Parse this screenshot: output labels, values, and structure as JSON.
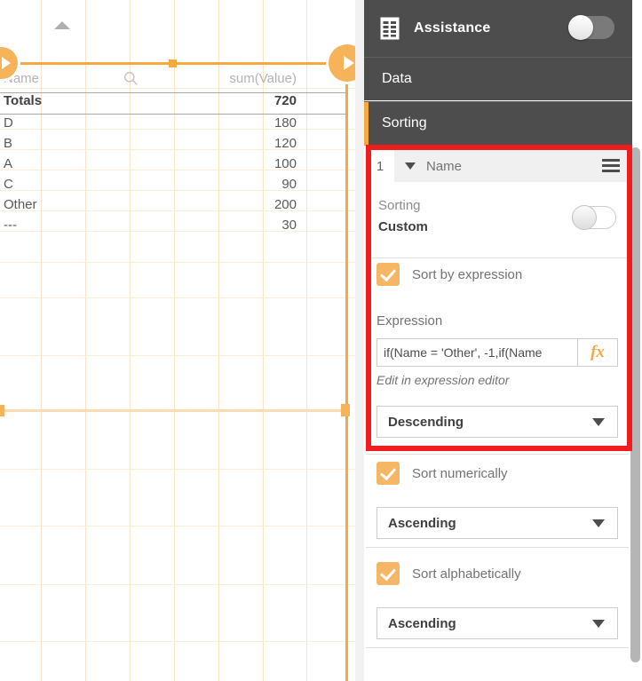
{
  "panel": {
    "title": "Assistance",
    "icon": "table-icon",
    "toggle_state": "off",
    "tabs": [
      {
        "label": "Data",
        "active": false
      },
      {
        "label": "Sorting",
        "active": true
      }
    ],
    "accent_color": "#f5a93e",
    "highlight_color": "#ef1d1d"
  },
  "sorting": {
    "dimension": {
      "index": "1",
      "name": "Name",
      "menu_icon": "hamburger-icon"
    },
    "sorting_label": "Sorting",
    "sorting_value": "Custom",
    "sorting_toggle_state": "off",
    "sort_by_expression": {
      "label": "Sort by expression",
      "checked": true,
      "expression_label": "Expression",
      "expression_value": "if(Name = 'Other', -1,if(Name",
      "expression_placeholder": "Expression",
      "fx_icon": "fx-icon",
      "hint": "Edit in expression editor",
      "direction": "Descending"
    },
    "sort_numerically": {
      "label": "Sort numerically",
      "checked": true,
      "direction": "Ascending"
    },
    "sort_alphabetically": {
      "label": "Sort alphabetically",
      "checked": true,
      "direction": "Ascending"
    }
  },
  "chart": {
    "header": {
      "dimension": "Name",
      "measure": "sum(Value)",
      "search_icon": "search-icon",
      "sort_indicator": "sort-ascending-caret"
    },
    "totals_label": "Totals",
    "totals_value": "720",
    "rows": [
      {
        "name": "D",
        "value": "180"
      },
      {
        "name": "B",
        "value": "120"
      },
      {
        "name": "A",
        "value": "100"
      },
      {
        "name": "C",
        "value": "90"
      },
      {
        "name": "Other",
        "value": "200"
      },
      {
        "name": "---",
        "value": "30"
      }
    ],
    "grid_color": "#fbe3c4"
  },
  "chart_data": {
    "type": "table",
    "title": "",
    "categories": [
      "D",
      "B",
      "A",
      "C",
      "Other",
      "---"
    ],
    "values": [
      180,
      120,
      100,
      90,
      200,
      30
    ],
    "columns": [
      "Name",
      "sum(Value)"
    ],
    "total": 720,
    "xlabel": "Name",
    "ylabel": "sum(Value)"
  }
}
